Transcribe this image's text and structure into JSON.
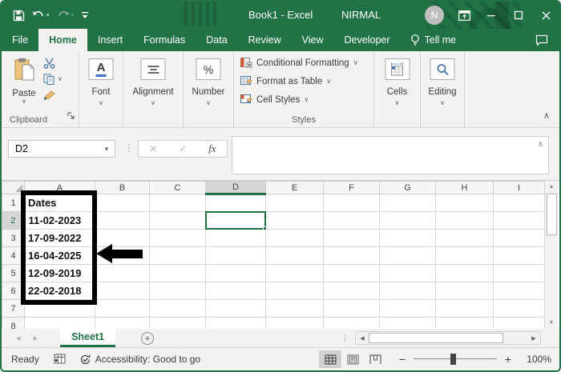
{
  "titlebar": {
    "title": "Book1  -  Excel",
    "user": "NIRMAL",
    "avatar_initial": "N"
  },
  "tabs": {
    "items": [
      "File",
      "Home",
      "Insert",
      "Formulas",
      "Data",
      "Review",
      "View",
      "Developer"
    ],
    "active": "Home",
    "tellme": "Tell me"
  },
  "ribbon": {
    "paste": "Paste",
    "clipboard_label": "Clipboard",
    "font_label": "Font",
    "font_glyph": "A",
    "alignment_label": "Alignment",
    "number_label": "Number",
    "number_glyph": "%",
    "styles": {
      "conditional": "Conditional Formatting",
      "format_table": "Format as Table",
      "cell_styles": "Cell Styles",
      "label": "Styles"
    },
    "cells_label": "Cells",
    "editing_label": "Editing"
  },
  "formula_bar": {
    "name_box": "D2",
    "fx": "fx",
    "input_value": ""
  },
  "grid": {
    "columns": [
      "A",
      "B",
      "C",
      "D",
      "E",
      "F",
      "G",
      "H",
      "I"
    ],
    "rows": [
      "1",
      "2",
      "3",
      "4",
      "5",
      "6",
      "7",
      "8"
    ],
    "selected_cell": "D2",
    "cells": {
      "A1": "Dates",
      "A2": "11-02-2023",
      "A3": "17-09-2022",
      "A4": "16-04-2025",
      "A5": "12-09-2019",
      "A6": "22-02-2018"
    }
  },
  "sheetbar": {
    "sheet": "Sheet1"
  },
  "statusbar": {
    "mode": "Ready",
    "accessibility": "Accessibility: Good to go",
    "zoom_level": "100%"
  },
  "icons": {
    "chevron_down": "∨",
    "chevron_up": "∧",
    "dropdown": "▾",
    "dots_vertical": "⋮",
    "nav_left": "◂",
    "nav_right": "▸",
    "scroll_up": "▲",
    "scroll_down": "▼",
    "scroll_left": "◀",
    "scroll_right": "▶",
    "plus": "+",
    "minus": "−"
  },
  "colors": {
    "excel_green": "#217346",
    "ribbon_bg": "#f3f2f1",
    "selected_header_bg": "#d6d6d6",
    "gridline": "#d9d9d9",
    "annotation_black": "#000000"
  }
}
